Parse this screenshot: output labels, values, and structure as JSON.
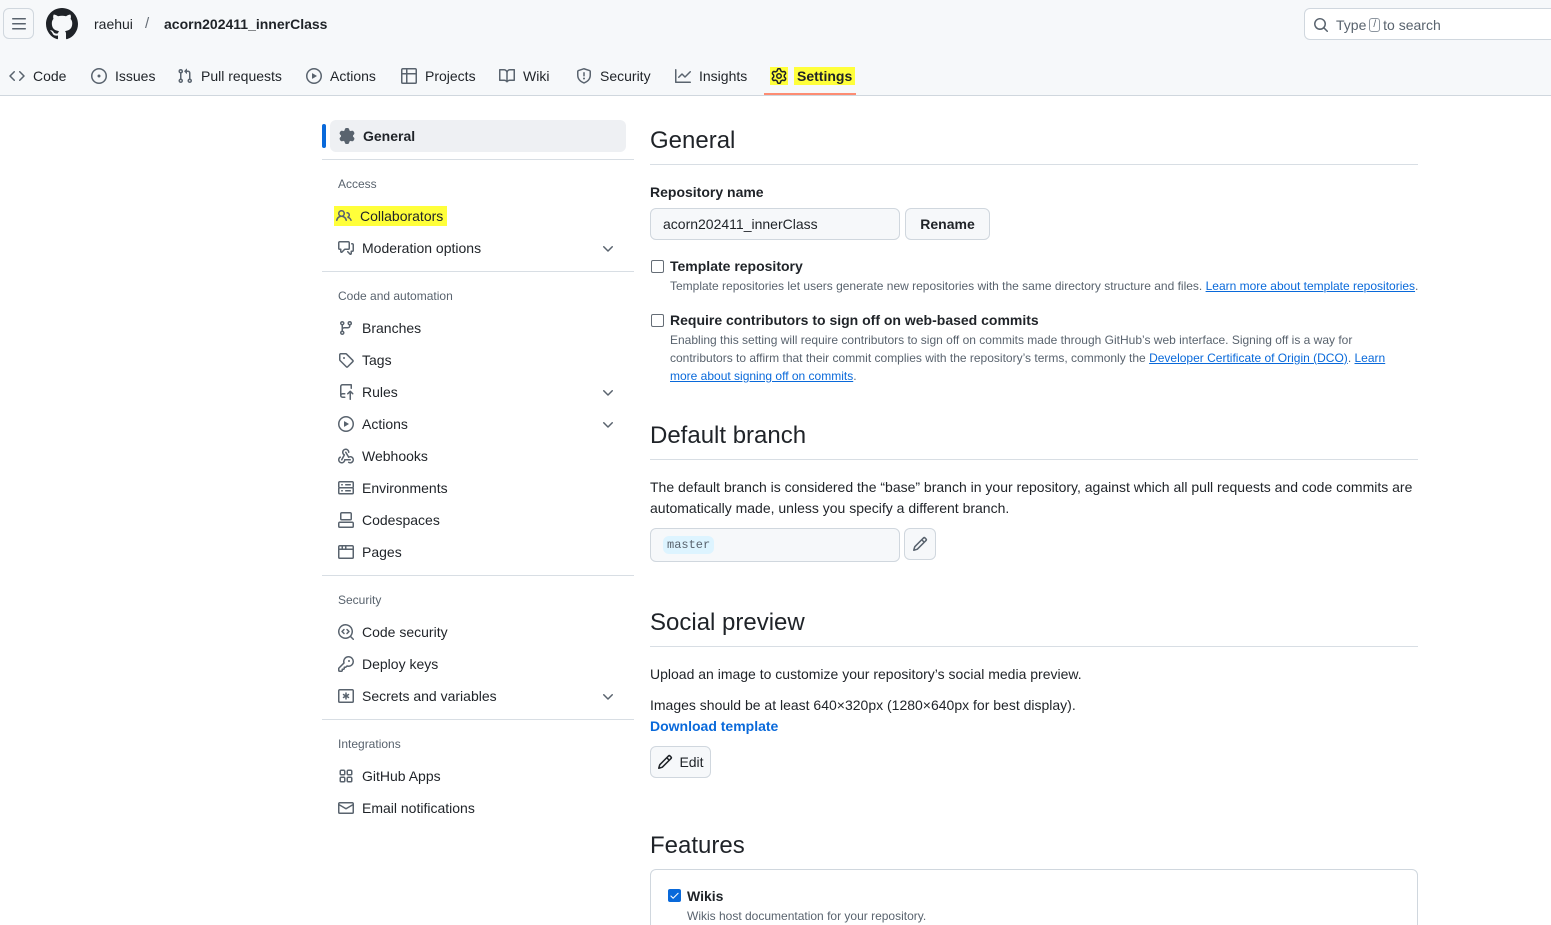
{
  "header": {
    "owner": "raehui",
    "separator": "/",
    "repo": "acorn202411_innerClass",
    "search_prefix": "Type",
    "search_key": "/",
    "search_suffix": "to search"
  },
  "repo_nav": {
    "items": [
      {
        "label": "Code",
        "icon": "code-icon"
      },
      {
        "label": "Issues",
        "icon": "issue-opened-icon"
      },
      {
        "label": "Pull requests",
        "icon": "git-pull-request-icon"
      },
      {
        "label": "Actions",
        "icon": "play-icon"
      },
      {
        "label": "Projects",
        "icon": "table-icon"
      },
      {
        "label": "Wiki",
        "icon": "book-icon"
      },
      {
        "label": "Security",
        "icon": "shield-icon"
      },
      {
        "label": "Insights",
        "icon": "graph-icon"
      },
      {
        "label": "Settings",
        "icon": "gear-icon",
        "selected": true
      }
    ]
  },
  "sidebar": {
    "general": "General",
    "access_heading": "Access",
    "collaborators": "Collaborators",
    "moderation": "Moderation options",
    "code_heading": "Code and automation",
    "branches": "Branches",
    "tags": "Tags",
    "rules": "Rules",
    "actions": "Actions",
    "webhooks": "Webhooks",
    "environments": "Environments",
    "codespaces": "Codespaces",
    "pages": "Pages",
    "security_heading": "Security",
    "code_security": "Code security",
    "deploy_keys": "Deploy keys",
    "secrets": "Secrets and variables",
    "integrations_heading": "Integrations",
    "github_apps": "GitHub Apps",
    "email_notifications": "Email notifications"
  },
  "main": {
    "general_title": "General",
    "repo_name_label": "Repository name",
    "repo_name_value": "acorn202411_innerClass",
    "rename_button": "Rename",
    "template_title": "Template repository",
    "template_desc": "Template repositories let users generate new repositories with the same directory structure and files.",
    "template_link": "Learn more about template repositories",
    "template_desc_end": ".",
    "signoff_title": "Require contributors to sign off on web-based commits",
    "signoff_desc_1": "Enabling this setting will require contributors to sign off on commits made through GitHub’s web interface. Signing off is a way for contributors to affirm that their commit complies with the repository’s terms, commonly the",
    "signoff_link_1": "Developer Certificate of Origin (DCO)",
    "signoff_mid": ".",
    "signoff_link_2": "Learn more about signing off on commits",
    "signoff_end": ".",
    "default_branch_title": "Default branch",
    "default_branch_desc": "The default branch is considered the “base” branch in your repository, against which all pull requests and code commits are automatically made, unless you specify a different branch.",
    "default_branch_value": "master",
    "social_title": "Social preview",
    "social_desc": "Upload an image to customize your repository’s social media preview.",
    "social_size": "Images should be at least 640×320px (1280×640px for best display).",
    "download_template": "Download template",
    "edit_button": "Edit",
    "features_title": "Features",
    "wikis_title": "Wikis",
    "wikis_desc": "Wikis host documentation for your repository."
  },
  "colors": {
    "accent": "#0969da",
    "highlight": "#ffff3a",
    "underline": "#fd8c73"
  }
}
